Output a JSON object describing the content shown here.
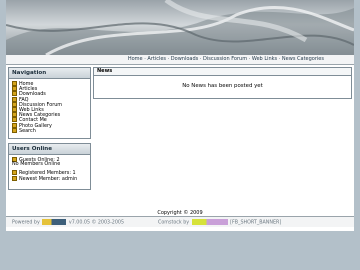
{
  "header": {
    "nav_links": "Home · Articles · Downloads · Discussion Forum · Web Links · News Categories"
  },
  "navigation": {
    "title": "Navigation",
    "items": [
      "Home",
      "Articles",
      "Downloads",
      "FAQ",
      "Discussion Forum",
      "Web Links",
      "News Categories",
      "Contact Me",
      "Photo Gallery",
      "Search"
    ]
  },
  "news": {
    "title": "News",
    "empty_text": "No News has been posted yet"
  },
  "users_online": {
    "title": "Users Online",
    "guests": "Guests Online: 2",
    "members": "No Members Online",
    "registered": "Registered Members: 1",
    "newest": "Newest Member: admin"
  },
  "footer": {
    "copyright": "Copyright © 2009",
    "powered": "Powered by",
    "version": "v7.00.05 © 2003-2005",
    "comstock": "Comstock by",
    "banner_tag": "[FB_SHORT_BANNER]"
  },
  "colors": {
    "background": "#b3c0c9",
    "bullet": "#d5a51c",
    "panel_border": "#7f8d97"
  }
}
